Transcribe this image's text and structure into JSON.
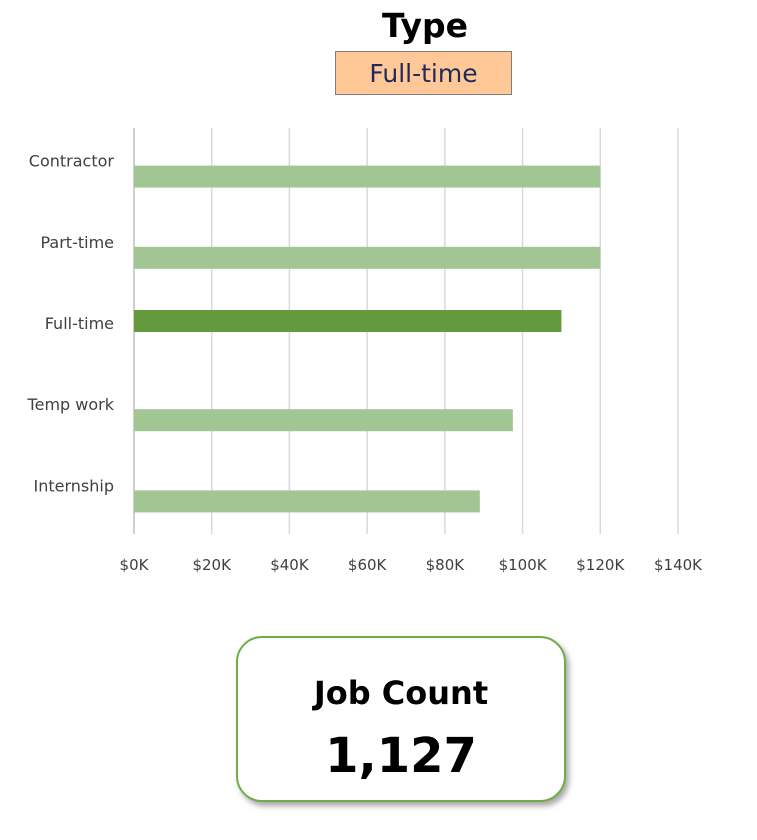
{
  "header": {
    "title": "Type",
    "slicer_value": "Full-time"
  },
  "chart_data": {
    "type": "bar",
    "orientation": "horizontal",
    "categories": [
      "Contractor",
      "Part-time",
      "Full-time",
      "Temp work",
      "Internship"
    ],
    "values": [
      120000,
      120000,
      110000,
      97500,
      89000
    ],
    "highlighted_category": "Full-time",
    "xlim": [
      0,
      140000
    ],
    "x_ticks": [
      0,
      20000,
      40000,
      60000,
      80000,
      100000,
      120000,
      140000
    ],
    "x_tick_labels": [
      "$0K",
      "$20K",
      "$40K",
      "$60K",
      "$80K",
      "$100K",
      "$120K",
      "$140K"
    ],
    "grid": true,
    "legend": "none",
    "colors": {
      "bar": "#a1c693",
      "bar_highlight": "#64993d",
      "grid": "#d9d9d9",
      "axis": "#bfbfbf",
      "tick_text": "#404040"
    }
  },
  "card": {
    "label": "Job Count",
    "value": "1,127",
    "border_color": "#70ad47"
  }
}
